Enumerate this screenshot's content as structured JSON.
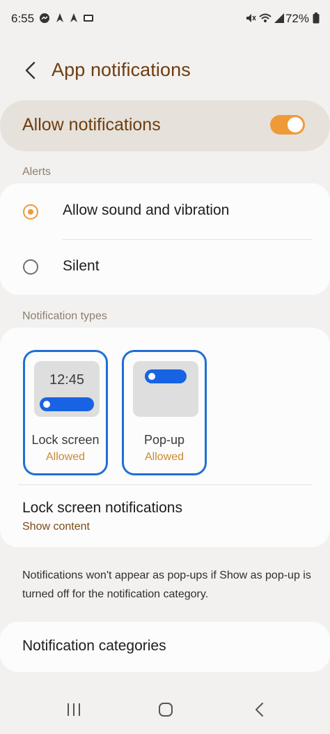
{
  "status_bar": {
    "time": "6:55",
    "battery_text": "72%",
    "left_icons": [
      "messenger-icon",
      "app-icon-1",
      "app-icon-2",
      "gallery-icon"
    ],
    "right_icons": [
      "mute-icon",
      "wifi-icon",
      "signal-icon",
      "battery-icon"
    ]
  },
  "header": {
    "title": "App notifications"
  },
  "allow_notifications": {
    "label": "Allow notifications",
    "enabled": true
  },
  "alerts": {
    "section_label": "Alerts",
    "options": [
      {
        "label": "Allow sound and vibration",
        "selected": true
      },
      {
        "label": "Silent",
        "selected": false
      }
    ]
  },
  "notification_types": {
    "section_label": "Notification types",
    "tiles": [
      {
        "title": "Lock screen",
        "status": "Allowed",
        "preview_time": "12:45"
      },
      {
        "title": "Pop-up",
        "status": "Allowed"
      }
    ],
    "lock_screen_row": {
      "title": "Lock screen notifications",
      "subtitle": "Show content"
    }
  },
  "info_text": "Notifications won't appear as pop-ups if Show as pop-up is turned off for the notification category.",
  "categories": {
    "label": "Notification categories"
  },
  "colors": {
    "accent": "#ef9a38",
    "title_brown": "#6e3d10",
    "tile_blue": "#1f6fd6"
  }
}
